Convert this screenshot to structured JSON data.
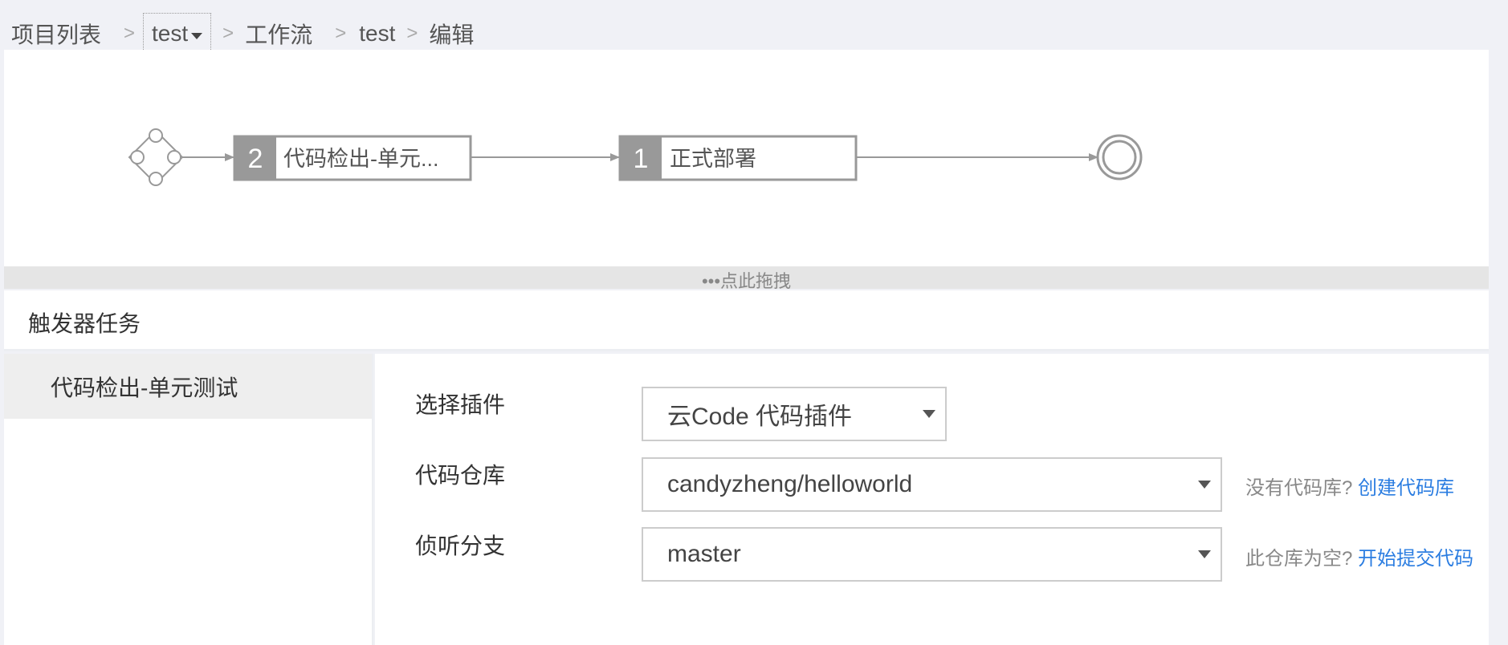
{
  "breadcrumb": {
    "project_list": "项目列表",
    "project": "test",
    "workflow": "工作流",
    "workflow_name": "test",
    "current": "编辑",
    "separator": ">"
  },
  "flow": {
    "stages": [
      {
        "count": "2",
        "label": "代码检出-单元..."
      },
      {
        "count": "1",
        "label": "正式部署"
      }
    ]
  },
  "drag_bar": {
    "label": "•••点此拖拽"
  },
  "trigger": {
    "title": "触发器任务",
    "tasks": [
      {
        "label": "代码检出-单元测试"
      }
    ]
  },
  "form": {
    "plugin": {
      "label": "选择插件",
      "value": "云Code 代码插件"
    },
    "repo": {
      "label": "代码仓库",
      "value": "candyzheng/helloworld",
      "hint_text": "没有代码库?",
      "hint_link": "创建代码库"
    },
    "branch": {
      "label": "侦听分支",
      "value": "master",
      "hint_text": "此仓库为空?",
      "hint_link": "开始提交代码"
    }
  },
  "colors": {
    "background": "#f0f1f6",
    "flow_gray": "#999999",
    "link_blue": "#2b7de1"
  }
}
